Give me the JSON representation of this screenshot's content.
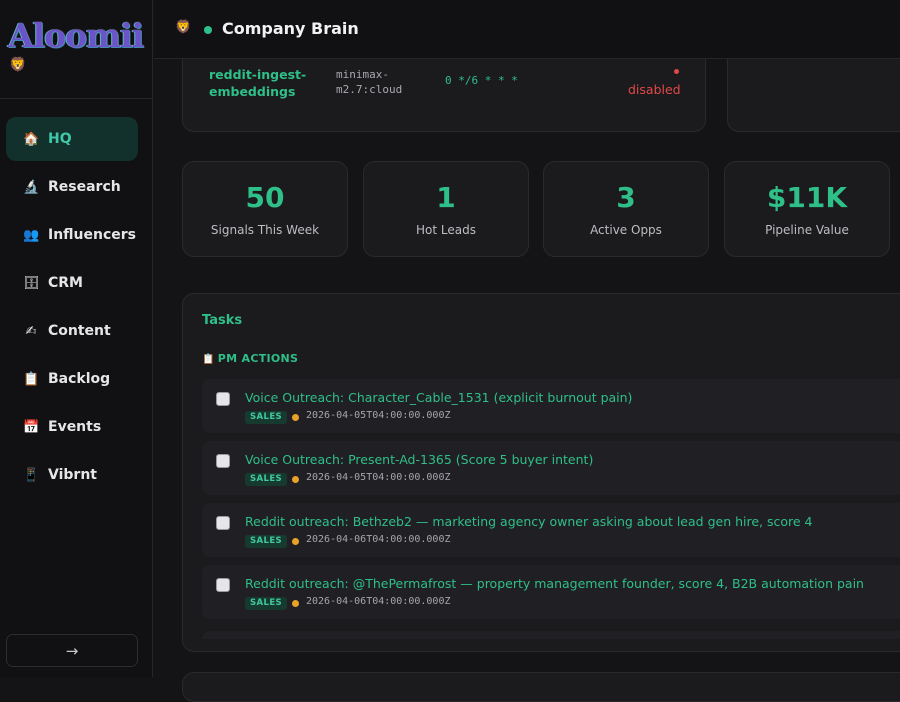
{
  "app": {
    "logo_text": "Aloomii",
    "logo_emoji": "🦁"
  },
  "sidebar": {
    "items": [
      {
        "icon": "🏠",
        "icon_name": "home-icon",
        "label": "HQ",
        "active": true
      },
      {
        "icon": "🔬",
        "icon_name": "microscope-icon",
        "label": "Research"
      },
      {
        "icon": "👥",
        "icon_name": "people-icon",
        "label": "Influencers"
      },
      {
        "icon": "🗄",
        "icon_name": "file-cabinet-icon",
        "label": "CRM"
      },
      {
        "icon": "✍",
        "icon_name": "writing-hand-icon",
        "label": "Content"
      },
      {
        "icon": "📋",
        "icon_name": "clipboard-icon",
        "label": "Backlog"
      },
      {
        "icon": "📅",
        "icon_name": "calendar-icon",
        "label": "Events"
      },
      {
        "icon": "📱",
        "icon_name": "mobile-phone-icon",
        "label": "Vibrnt"
      }
    ],
    "collapse_label": "→"
  },
  "header": {
    "emoji": "🦁",
    "status_color": "#2ec08a",
    "title": "Company Brain"
  },
  "cron_job": {
    "name": "reddit-ingest-embeddings",
    "model": "minimax-m2.7:cloud",
    "schedule": "0 */6 * * *",
    "status_dot": "•",
    "status": "disabled"
  },
  "stats": [
    {
      "value": "50",
      "label": "Signals This Week"
    },
    {
      "value": "1",
      "label": "Hot Leads"
    },
    {
      "value": "3",
      "label": "Active Opps"
    },
    {
      "value": "$11K",
      "label": "Pipeline Value"
    }
  ],
  "tasks": {
    "title": "Tasks",
    "section_icon": "📋",
    "section_label": "PM ACTIONS",
    "items": [
      {
        "title": "Voice Outreach: Character_Cable_1531 (explicit burnout pain)",
        "tag": "SALES",
        "date": "2026-04-05T04:00:00.000Z",
        "checked": false
      },
      {
        "title": "Voice Outreach: Present-Ad-1365 (Score 5 buyer intent)",
        "tag": "SALES",
        "date": "2026-04-05T04:00:00.000Z",
        "checked": false
      },
      {
        "title": "Reddit outreach: Bethzeb2 — marketing agency owner asking about lead gen hire, score 4",
        "tag": "SALES",
        "date": "2026-04-06T04:00:00.000Z",
        "checked": false
      },
      {
        "title": "Reddit outreach: @ThePermafrost — property management founder, score 4, B2B automation pain",
        "tag": "SALES",
        "date": "2026-04-06T04:00:00.000Z",
        "checked": false
      }
    ]
  },
  "colors": {
    "accent": "#2fbf88",
    "danger": "#e04848",
    "warning": "#e8a22a"
  }
}
